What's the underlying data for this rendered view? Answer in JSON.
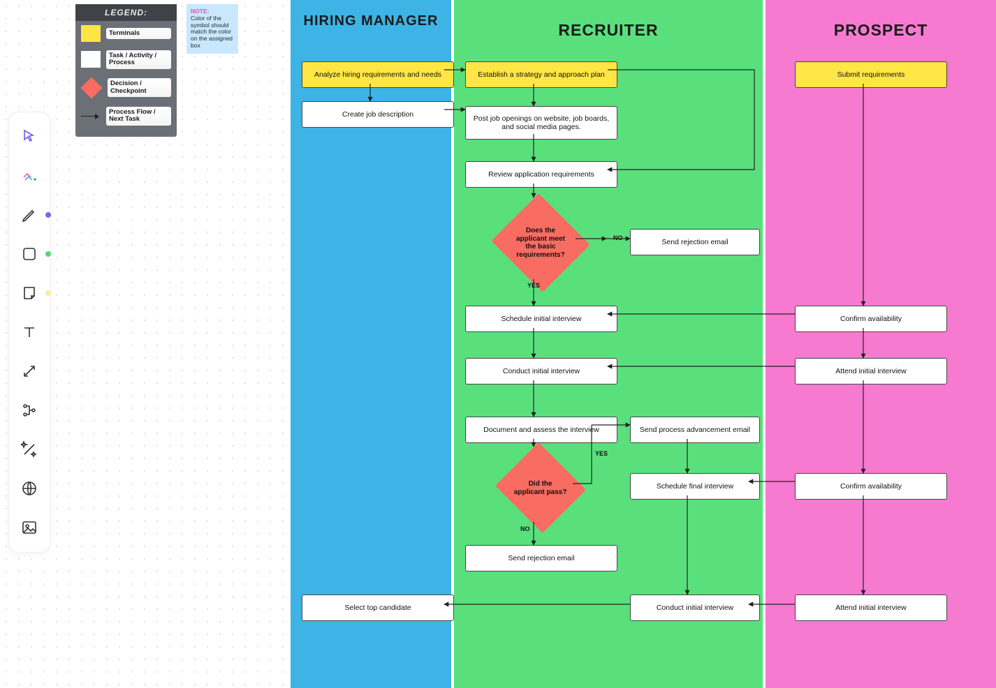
{
  "legend": {
    "title": "LEGEND:",
    "terminals": "Terminals",
    "task": "Task / Activity / Process",
    "decision": "Decision / Checkpoint",
    "flow": "Process Flow / Next Task"
  },
  "note": {
    "title": "NOTE:",
    "body": "Color of the symbol should match the color on the assigned box"
  },
  "lanes": {
    "lane1": "HIRING MANAGER",
    "lane2": "RECRUITER",
    "lane3": "PROSPECT"
  },
  "nodes": {
    "hm1": "Analyze hiring requirements and needs",
    "hm2": "Create job description",
    "hm3": "Select top candidate",
    "rc1": "Establish a strategy and approach plan",
    "rc2": "Post job openings on website, job boards, and social media pages.",
    "rc3": "Review application requirements",
    "rc4": "Does the applicant meet the basic requirements?",
    "rc5": "Send rejection email",
    "rc6": "Schedule initial interview",
    "rc7": "Conduct initial interview",
    "rc8": "Document and assess the interview",
    "rc9": "Did the applicant pass?",
    "rc10": "Send rejection email",
    "rc11": "Send process advancement email",
    "rc12": "Schedule final interview",
    "rc13": "Conduct initial interview",
    "pr1": "Submit requirements",
    "pr2": "Confirm availability",
    "pr3": "Attend initial interview",
    "pr4": "Confirm availability",
    "pr5": "Attend initial interview"
  },
  "labels": {
    "yes1": "YES",
    "no1": "NO",
    "yes2": "YES",
    "no2": "NO"
  }
}
